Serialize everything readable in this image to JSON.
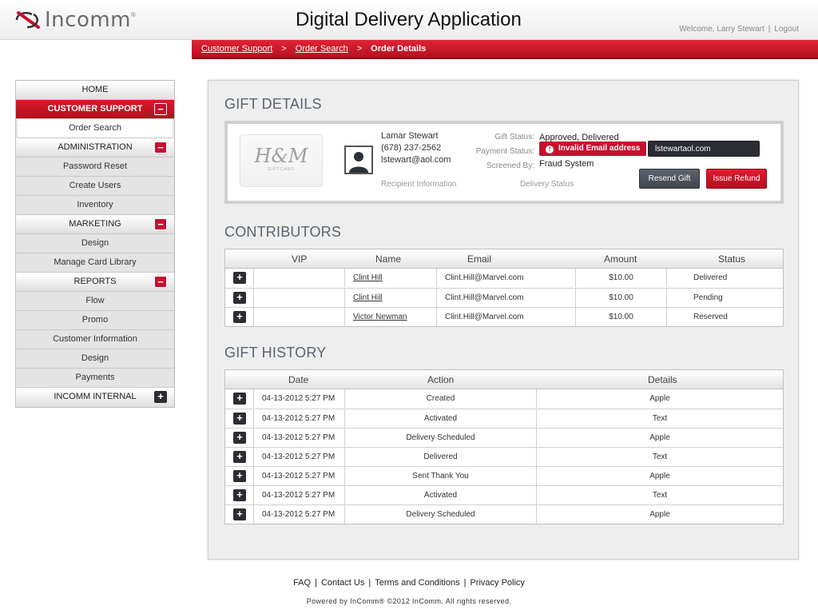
{
  "header": {
    "logo_text": "Incomm",
    "logo_reg": "®",
    "app_title": "Digital Delivery Application",
    "welcome": "Welcome, Larry Stewart",
    "logout": "Logout"
  },
  "breadcrumb": {
    "items": [
      "Customer Support",
      "Order Search"
    ],
    "current": "Order Details",
    "separator": ">"
  },
  "sidebar": {
    "home": "HOME",
    "customer_support": "CUSTOMER SUPPORT",
    "order_search": "Order Search",
    "administration": "ADMINISTRATION",
    "password_reset": "Password Reset",
    "create_users": "Create Users",
    "inventory": "Inventory",
    "marketing": "MARKETING",
    "design": "Design",
    "manage_card_library": "Manage Card Library",
    "reports": "REPORTS",
    "flow": "Flow",
    "promo": "Promo",
    "customer_information": "Customer Information",
    "design2": "Design",
    "payments": "Payments",
    "incomm_internal": "INCOMM INTERNAL",
    "minus": "−",
    "plus": "+"
  },
  "gift_details": {
    "title": "GIFT DETAILS",
    "card_logo": "H&M",
    "card_sub": "GIFTCARD",
    "recipient_name": "Lamar Stewart",
    "recipient_phone": "(678) 237-2562",
    "recipient_email": "lstewart@aol.com",
    "recipient_label": "Recipient Information",
    "gift_status_label": "Gift Status:",
    "gift_status_value": "Approved, Delivered",
    "payment_status_label": "Payment Status:",
    "error_icon": "!",
    "error_text": "Invalid Email address",
    "email_input_value": "lstewartaol.com",
    "screened_label": "Screened By:",
    "screened_value": "Fraud System",
    "delivery_label": "Delivery Status",
    "resend_label": "Resend Gift",
    "refund_label": "Issue Refund"
  },
  "contributors": {
    "title": "CONTRIBUTORS",
    "headers": [
      "VIP",
      "Name",
      "Email",
      "Amount",
      "Status"
    ],
    "rows": [
      {
        "name": "Clint Hill",
        "email": "Clint.Hill@Marvel.com",
        "amount": "$10.00",
        "status": "Delivered"
      },
      {
        "name": "Clint Hill",
        "email": "Clint.Hill@Marvel.com",
        "amount": "$10.00",
        "status": "Pending"
      },
      {
        "name": "Victor Newman",
        "email": "Clint.Hill@Marvel.com",
        "amount": "$10.00",
        "status": "Reserved"
      }
    ]
  },
  "history": {
    "title": "GIFT HISTORY",
    "headers": [
      "Date",
      "Action",
      "Details"
    ],
    "rows": [
      {
        "date": "04-13-2012 5:27 PM",
        "action": "Created",
        "details": "Apple"
      },
      {
        "date": "04-13-2012 5:27 PM",
        "action": "Activated",
        "details": "Text"
      },
      {
        "date": "04-13-2012 5:27 PM",
        "action": "Delivery Scheduled",
        "details": "Apple"
      },
      {
        "date": "04-13-2012 5:27 PM",
        "action": "Delivered",
        "details": "Text"
      },
      {
        "date": "04-13-2012 5:27 PM",
        "action": "Sent Thank You",
        "details": "Apple"
      },
      {
        "date": "04-13-2012 5:27 PM",
        "action": "Activated",
        "details": "Text"
      },
      {
        "date": "04-13-2012 5:27 PM",
        "action": "Delivery Scheduled",
        "details": "Apple"
      }
    ]
  },
  "footer": {
    "faq": "FAQ",
    "contact": "Contact Us",
    "terms": "Terms and Conditions",
    "privacy": "Privacy Policy",
    "separator": "|",
    "powered": "Powered by InComm® ©2012 InComm. All rights reserved."
  },
  "colors": {
    "brand_red": "#c8102e",
    "dark_button": "#2a2d33",
    "section_title": "#5a6470"
  }
}
